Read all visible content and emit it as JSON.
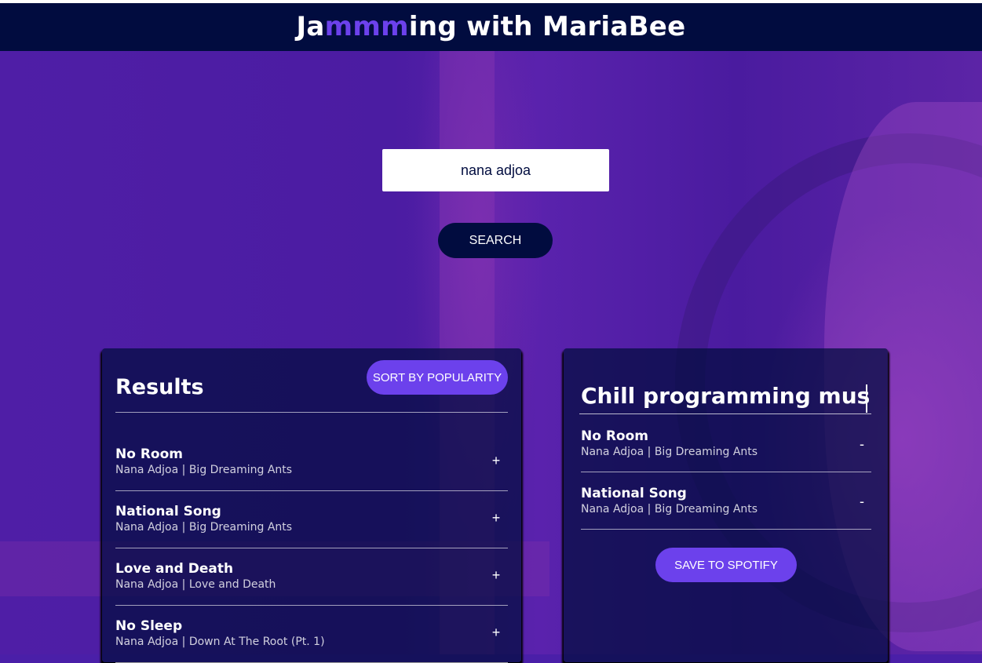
{
  "header": {
    "title_prefix": "Ja",
    "title_highlight": "mmm",
    "title_suffix": "ing with MariaBee",
    "highlight_color": "#6c41ec",
    "bar_color": "#010c3f"
  },
  "search": {
    "value": "nana adjoa",
    "button_label": "SEARCH"
  },
  "results": {
    "title": "Results",
    "sort_label": "SORT BY POPULARITY",
    "tracks": [
      {
        "name": "No Room",
        "info": "Nana Adjoa | Big Dreaming Ants",
        "action": "+"
      },
      {
        "name": "National Song",
        "info": "Nana Adjoa | Big Dreaming Ants",
        "action": "+"
      },
      {
        "name": "Love and Death",
        "info": "Nana Adjoa | Love and Death",
        "action": "+"
      },
      {
        "name": "No Sleep",
        "info": "Nana Adjoa | Down At The Root (Pt. 1)",
        "action": "+"
      }
    ]
  },
  "playlist": {
    "name": "Chill programming music",
    "tracks": [
      {
        "name": "No Room",
        "info": "Nana Adjoa | Big Dreaming Ants",
        "action": "-"
      },
      {
        "name": "National Song",
        "info": "Nana Adjoa | Big Dreaming Ants",
        "action": "-"
      }
    ],
    "save_label": "SAVE TO SPOTIFY"
  }
}
